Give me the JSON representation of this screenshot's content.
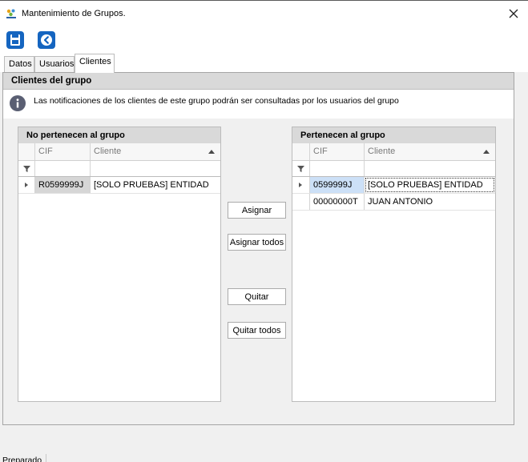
{
  "window": {
    "title": "Mantenimiento de Grupos.",
    "close_icon": "close-x-icon"
  },
  "toolbar": {
    "save_icon": "floppy-disk-save-icon",
    "back_icon": "back-arrow-circle-icon"
  },
  "tabs": [
    {
      "label": "Datos",
      "active": false
    },
    {
      "label": "Usuarios",
      "active": false
    },
    {
      "label": "Clientes",
      "active": true
    }
  ],
  "group": {
    "header": "Clientes del grupo",
    "info_text": "Las notificaciones de los clientes de este grupo podrán ser consultadas por los usuarios del grupo"
  },
  "left_grid": {
    "title": "No pertenecen al grupo",
    "columns": [
      "CIF",
      "Cliente"
    ],
    "rows": [
      {
        "cif": "R0599999J",
        "cliente": "[SOLO PRUEBAS] ENTIDAD"
      }
    ]
  },
  "right_grid": {
    "title": "Pertenecen al grupo",
    "columns": [
      "CIF",
      "Cliente"
    ],
    "rows": [
      {
        "cif": "0599999J",
        "cliente": "[SOLO PRUEBAS] ENTIDAD"
      },
      {
        "cif": "00000000T",
        "cliente": "JUAN ANTONIO"
      }
    ]
  },
  "buttons": {
    "assign": "Asignar",
    "assign_all": "Asignar todos",
    "remove": "Quitar",
    "remove_all": "Quitar todos"
  },
  "status": {
    "text": "Preparado"
  },
  "colors": {
    "accent_blue": "#1565c0",
    "selected_cell": "#cce0f7",
    "header_gray": "#d9d9d9",
    "info_icon": "#5a5f73"
  }
}
